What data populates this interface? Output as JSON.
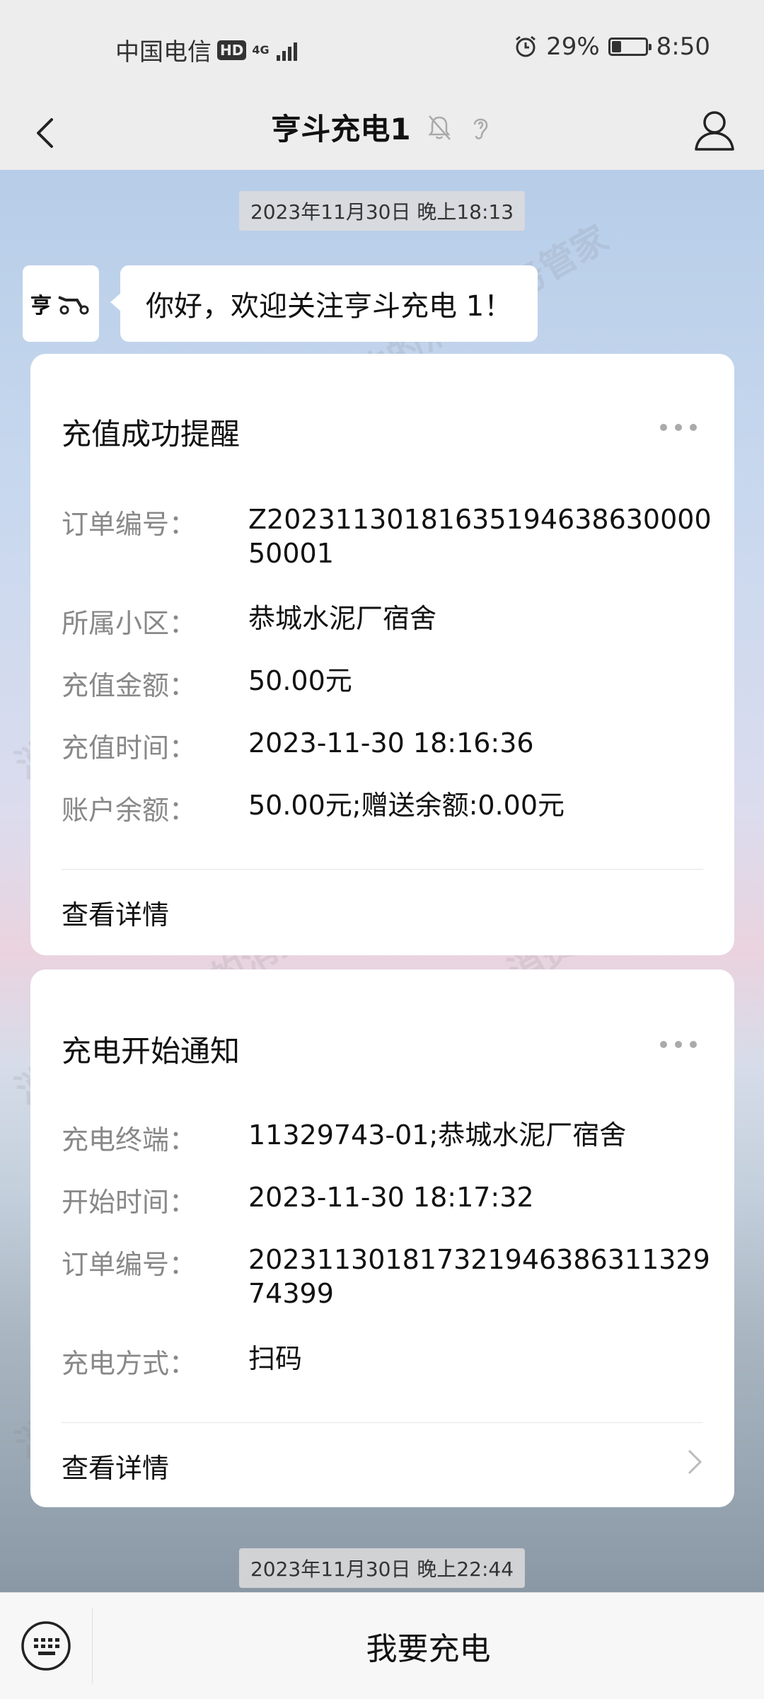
{
  "status_bar": {
    "carrier": "中国电信",
    "hd": "HD",
    "network": "4G",
    "battery_text": "29%",
    "battery_level": 0.29,
    "time": "8:50"
  },
  "nav": {
    "title": "亨斗充电1"
  },
  "chat": {
    "timestamp_1": "2023年11月30日 晚上18:13",
    "avatar_text": "亨",
    "welcome": "你好，欢迎关注亨斗充电 1！",
    "card1": {
      "title": "充值成功提醒",
      "rows": [
        {
          "label": "订单编号：",
          "value": "Z2023113018163519463863000050001"
        },
        {
          "label": "所属小区：",
          "value": "恭城水泥厂宿舍"
        },
        {
          "label": "充值金额：",
          "value": "50.00元"
        },
        {
          "label": "充值时间：",
          "value": "2023-11-30 18:16:36"
        },
        {
          "label": "账户余额：",
          "value": "50.00元;赠送余额:0.00元"
        }
      ],
      "detail": "查看详情"
    },
    "card2": {
      "title": "充电开始通知",
      "rows": [
        {
          "label": "充电终端：",
          "value": "11329743-01;恭城水泥厂宿舍"
        },
        {
          "label": "开始时间：",
          "value": "2023-11-30 18:17:32"
        },
        {
          "label": "订单编号：",
          "value": "20231130181732194638631132974399"
        },
        {
          "label": "充电方式：",
          "value": "扫码"
        }
      ],
      "detail": "查看详情"
    },
    "timestamp_2": "2023年11月30日 晚上22:44"
  },
  "watermark": {
    "text_a": "消费保 您身边的消费服务管家",
    "text_b": "消费保 您身边"
  },
  "bottom": {
    "charge_button": "我要充电"
  },
  "colors": {
    "background": "#ededed",
    "card": "#ffffff",
    "label": "#888888",
    "text": "#111111"
  }
}
